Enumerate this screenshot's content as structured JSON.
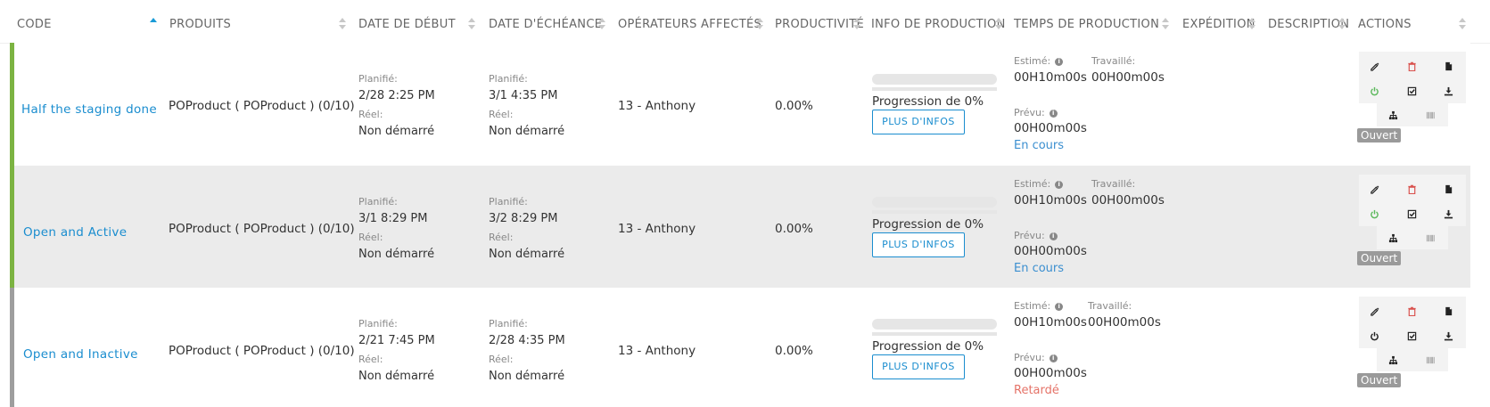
{
  "header": {
    "columns": [
      {
        "label": "CODE",
        "sort": "asc"
      },
      {
        "label": "PRODUITS",
        "sort": "none"
      },
      {
        "label": "DATE DE DÉBUT",
        "sort": "none"
      },
      {
        "label": "DATE D'ÉCHÉANCE",
        "sort": "none"
      },
      {
        "label": "OPÉRATEURS AFFECTÉS",
        "sort": "none"
      },
      {
        "label": "PRODUCTIVITÉ",
        "sort": "none"
      },
      {
        "label": "INFO DE PRODUCTION",
        "sort": "none"
      },
      {
        "label": "TEMPS DE PRODUCTION",
        "sort": "none"
      },
      {
        "label": "EXPÉDITION",
        "sort": "none"
      },
      {
        "label": "DESCRIPTION",
        "sort": "none"
      },
      {
        "label": "ACTIONS",
        "sort": "none"
      }
    ]
  },
  "labels": {
    "planned": "Planifié:",
    "real": "Réel:",
    "estimated": "Estimé:",
    "worked": "Travaillé:",
    "expected": "Prévu:",
    "more_info": "PLUS D'INFOS"
  },
  "rows": [
    {
      "code": "Half the staging done",
      "product": "POProduct ( POProduct ) (0/10)",
      "start_planned": "2/28   2:25 PM",
      "start_real": "Non démarré",
      "due_planned": "3/1   4:35 PM",
      "due_real": "Non démarré",
      "operators": "13 - Anthony",
      "productivity": "0.00%",
      "progress_text": "Progression de 0%",
      "progress": 0,
      "estimated": "00H10m00s",
      "worked": "00H00m00s",
      "expected": "00H00m00s",
      "status": "En cours",
      "badge": "Ouvert",
      "bar_color": "#7cb342",
      "status_color": "#3b8fd0",
      "power_color": "#5cb85c"
    },
    {
      "code": "Open and Active",
      "product": "POProduct ( POProduct ) (0/10)",
      "start_planned": "3/1   8:29 PM",
      "start_real": "Non démarré",
      "due_planned": "3/2   8:29 PM",
      "due_real": "Non démarré",
      "operators": "13 - Anthony",
      "productivity": "0.00%",
      "progress_text": "Progression de 0%",
      "progress": 0,
      "estimated": "00H10m00s",
      "worked": "00H00m00s",
      "expected": "00H00m00s",
      "status": "En cours",
      "badge": "Ouvert",
      "bar_color": "#7cb342",
      "status_color": "#3b8fd0",
      "power_color": "#5cb85c"
    },
    {
      "code": "Open and Inactive",
      "product": "POProduct ( POProduct ) (0/10)",
      "start_planned": "2/21   7:45 PM",
      "start_real": "Non démarré",
      "due_planned": "2/28   4:35 PM",
      "due_real": "Non démarré",
      "operators": "13 - Anthony",
      "productivity": "0.00%",
      "progress_text": "Progression de 0%",
      "progress": 0,
      "estimated": "00H10m00s",
      "worked": "00H00m00s",
      "expected": "00H00m00s",
      "status": "Retardé",
      "badge": "Ouvert",
      "bar_color": "#9e9e9e",
      "status_color": "#e57368",
      "power_color": "#222222"
    }
  ],
  "colors": {
    "accent": "#1a8dcf",
    "row_alt_bg": "#ebebeb",
    "delete_icon": "#d9534f"
  },
  "icons": [
    "edit-icon",
    "trash-icon",
    "file-icon",
    "power-icon",
    "check-square-icon",
    "download-icon",
    "sitemap-icon",
    "barcode-icon",
    "info-icon",
    "sort-icon"
  ]
}
